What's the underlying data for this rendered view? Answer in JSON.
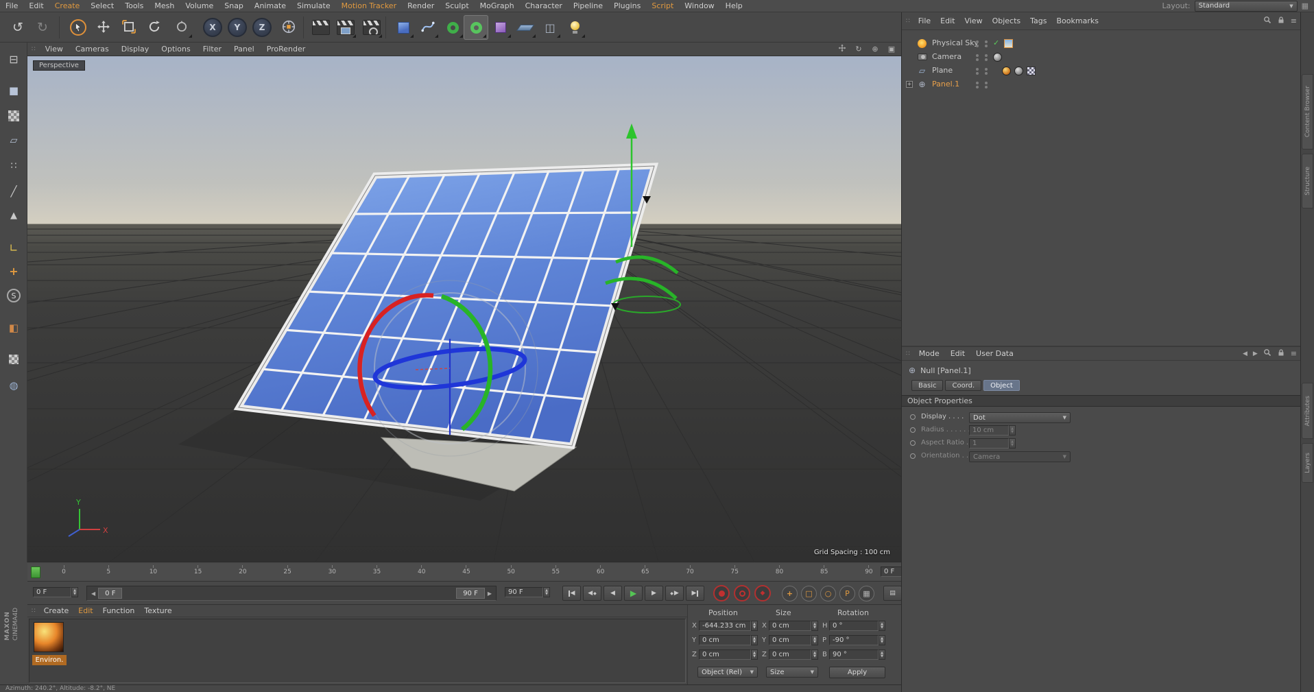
{
  "menubar": {
    "items": [
      {
        "label": "File"
      },
      {
        "label": "Edit"
      },
      {
        "label": "Create",
        "accent": true
      },
      {
        "label": "Select"
      },
      {
        "label": "Tools"
      },
      {
        "label": "Mesh"
      },
      {
        "label": "Volume"
      },
      {
        "label": "Snap"
      },
      {
        "label": "Animate"
      },
      {
        "label": "Simulate"
      },
      {
        "label": "Motion Tracker",
        "accent": true
      },
      {
        "label": "Render"
      },
      {
        "label": "Sculpt"
      },
      {
        "label": "MoGraph"
      },
      {
        "label": "Character"
      },
      {
        "label": "Pipeline"
      },
      {
        "label": "Plugins"
      },
      {
        "label": "Script",
        "accent": true
      },
      {
        "label": "Window"
      },
      {
        "label": "Help"
      }
    ],
    "layout_label": "Layout:",
    "layout_value": "Standard"
  },
  "toolbar": {
    "axis_x": "X",
    "axis_y": "Y",
    "axis_z": "Z"
  },
  "left_toolbar": {
    "snap_letter": "S"
  },
  "viewport": {
    "menu": [
      "View",
      "Cameras",
      "Display",
      "Options",
      "Filter",
      "Panel",
      "ProRender"
    ],
    "camera_label": "Perspective",
    "grid_spacing": "Grid Spacing : 100 cm",
    "axis_x": "X",
    "axis_y": "Y"
  },
  "timeline": {
    "ticks": [
      "0",
      "5",
      "10",
      "15",
      "20",
      "25",
      "30",
      "35",
      "40",
      "45",
      "50",
      "55",
      "60",
      "65",
      "70",
      "75",
      "80",
      "85",
      "90"
    ],
    "current": "0 F"
  },
  "transport": {
    "frame_field": "0 F",
    "slider_handle": "0 F",
    "slider_end": "90 F",
    "end_field": "90 F",
    "parameter_letter": "P"
  },
  "material_manager": {
    "menu": [
      {
        "label": "Create"
      },
      {
        "label": "Edit",
        "accent": true
      },
      {
        "label": "Function"
      },
      {
        "label": "Texture"
      }
    ],
    "materials": [
      {
        "name": "Environ."
      }
    ]
  },
  "coordinates": {
    "position": {
      "title": "Position",
      "x": "-644.233 cm",
      "y": "0 cm",
      "z": "0 cm"
    },
    "size": {
      "title": "Size",
      "x": "0 cm",
      "y": "0 cm",
      "z": "0 cm"
    },
    "rotation": {
      "title": "Rotation",
      "h": "0 °",
      "p": "-90 °",
      "b": "90 °"
    },
    "axis": {
      "x": "X",
      "y": "Y",
      "z": "Z",
      "h": "H",
      "p": "P",
      "b": "B"
    },
    "mode_select": "Object (Rel)",
    "size_select": "Size",
    "apply_label": "Apply"
  },
  "object_manager": {
    "tabs": [
      "File",
      "Edit",
      "View",
      "Objects",
      "Tags",
      "Bookmarks"
    ],
    "objects": [
      {
        "name": "Physical Sky"
      },
      {
        "name": "Camera"
      },
      {
        "name": "Plane"
      },
      {
        "name": "Panel.1"
      }
    ]
  },
  "attribute_manager": {
    "menu": [
      "Mode",
      "Edit",
      "User Data"
    ],
    "title": "Null [Panel.1]",
    "tabs": [
      {
        "label": "Basic"
      },
      {
        "label": "Coord."
      },
      {
        "label": "Object",
        "active": true
      }
    ],
    "section": "Object Properties",
    "props": {
      "display_label": "Display . . . .",
      "display_value": "Dot",
      "radius_label": "Radius . . . . . .",
      "radius_value": "10 cm",
      "aspect_label": "Aspect Ratio .",
      "aspect_value": "1",
      "orientation_label": "Orientation . .",
      "orientation_value": "Camera"
    }
  },
  "side_tabs": {
    "top": [
      "Content Browser",
      "Structure"
    ],
    "bottom": [
      "Attributes",
      "Layers"
    ]
  },
  "branding": {
    "line1": "MAXON",
    "line2": "CINEMA4D"
  },
  "status_bar": {
    "text": "Azimuth: 240.2°, Altitude: -8.2°, NE"
  }
}
